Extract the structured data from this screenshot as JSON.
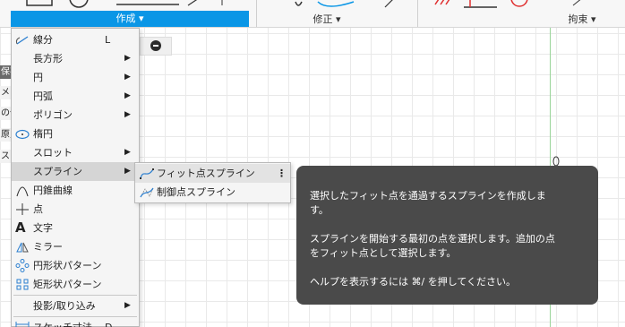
{
  "ribbon": {
    "create_label": "作成 ▾",
    "modify_label": "修正 ▾",
    "constraints_label": "拘束 ▾",
    "selection_color": "#0a96e6"
  },
  "browser_fragments": [
    "保存",
    "メ",
    "の作",
    "原点",
    "ス"
  ],
  "menu": {
    "items": [
      {
        "label": "線分",
        "shortcut": "L",
        "icon": "line-icon",
        "submenu": false
      },
      {
        "label": "長方形",
        "shortcut": "",
        "icon": "",
        "submenu": true
      },
      {
        "label": "円",
        "shortcut": "",
        "icon": "",
        "submenu": true
      },
      {
        "label": "円弧",
        "shortcut": "",
        "icon": "",
        "submenu": true
      },
      {
        "label": "ポリゴン",
        "shortcut": "",
        "icon": "",
        "submenu": true
      },
      {
        "label": "楕円",
        "shortcut": "",
        "icon": "ellipse-icon",
        "submenu": false
      },
      {
        "label": "スロット",
        "shortcut": "",
        "icon": "",
        "submenu": true
      },
      {
        "label": "スプライン",
        "shortcut": "",
        "icon": "",
        "submenu": true,
        "highlighted": true
      },
      {
        "label": "円錐曲線",
        "shortcut": "",
        "icon": "conic-curve-icon",
        "submenu": false
      },
      {
        "label": "点",
        "shortcut": "",
        "icon": "point-icon",
        "submenu": false
      },
      {
        "label": "文字",
        "shortcut": "",
        "icon": "text-icon",
        "submenu": false
      },
      {
        "label": "ミラー",
        "shortcut": "",
        "icon": "mirror-icon",
        "submenu": false
      },
      {
        "label": "円形状パターン",
        "shortcut": "",
        "icon": "circular-pattern-icon",
        "submenu": false
      },
      {
        "label": "矩形状パターン",
        "shortcut": "",
        "icon": "rectangular-pattern-icon",
        "submenu": false
      },
      {
        "label": "投影/取り込み",
        "shortcut": "",
        "icon": "",
        "submenu": true
      },
      {
        "label": "スケッチ寸法",
        "shortcut": "D",
        "icon": "sketch-dimension-icon",
        "submenu": false
      }
    ]
  },
  "submenu": {
    "items": [
      {
        "label": "フィット点スプライン",
        "icon": "fit-point-spline-icon",
        "more": "⋮"
      },
      {
        "label": "制御点スプライン",
        "icon": "control-point-spline-icon"
      }
    ]
  },
  "tooltip": {
    "line1": "選択したフィット点を通過するスプラインを作成しま",
    "line2": "す。",
    "line3": "スプラインを開始する最初の点を選択します。追加の点",
    "line4": "をフィット点として選択します。",
    "line5": "ヘルプを表示するには ⌘/ を押してください。"
  }
}
